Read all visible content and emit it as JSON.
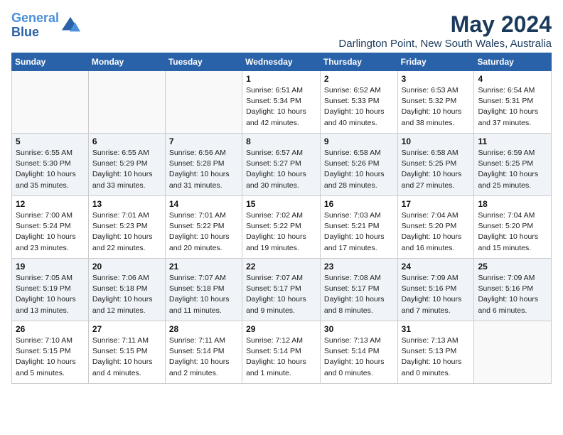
{
  "header": {
    "logo_line1": "General",
    "logo_line2": "Blue",
    "month": "May 2024",
    "location": "Darlington Point, New South Wales, Australia"
  },
  "days_of_week": [
    "Sunday",
    "Monday",
    "Tuesday",
    "Wednesday",
    "Thursday",
    "Friday",
    "Saturday"
  ],
  "weeks": [
    [
      {
        "day": "",
        "info": ""
      },
      {
        "day": "",
        "info": ""
      },
      {
        "day": "",
        "info": ""
      },
      {
        "day": "1",
        "info": "Sunrise: 6:51 AM\nSunset: 5:34 PM\nDaylight: 10 hours\nand 42 minutes."
      },
      {
        "day": "2",
        "info": "Sunrise: 6:52 AM\nSunset: 5:33 PM\nDaylight: 10 hours\nand 40 minutes."
      },
      {
        "day": "3",
        "info": "Sunrise: 6:53 AM\nSunset: 5:32 PM\nDaylight: 10 hours\nand 38 minutes."
      },
      {
        "day": "4",
        "info": "Sunrise: 6:54 AM\nSunset: 5:31 PM\nDaylight: 10 hours\nand 37 minutes."
      }
    ],
    [
      {
        "day": "5",
        "info": "Sunrise: 6:55 AM\nSunset: 5:30 PM\nDaylight: 10 hours\nand 35 minutes."
      },
      {
        "day": "6",
        "info": "Sunrise: 6:55 AM\nSunset: 5:29 PM\nDaylight: 10 hours\nand 33 minutes."
      },
      {
        "day": "7",
        "info": "Sunrise: 6:56 AM\nSunset: 5:28 PM\nDaylight: 10 hours\nand 31 minutes."
      },
      {
        "day": "8",
        "info": "Sunrise: 6:57 AM\nSunset: 5:27 PM\nDaylight: 10 hours\nand 30 minutes."
      },
      {
        "day": "9",
        "info": "Sunrise: 6:58 AM\nSunset: 5:26 PM\nDaylight: 10 hours\nand 28 minutes."
      },
      {
        "day": "10",
        "info": "Sunrise: 6:58 AM\nSunset: 5:25 PM\nDaylight: 10 hours\nand 27 minutes."
      },
      {
        "day": "11",
        "info": "Sunrise: 6:59 AM\nSunset: 5:25 PM\nDaylight: 10 hours\nand 25 minutes."
      }
    ],
    [
      {
        "day": "12",
        "info": "Sunrise: 7:00 AM\nSunset: 5:24 PM\nDaylight: 10 hours\nand 23 minutes."
      },
      {
        "day": "13",
        "info": "Sunrise: 7:01 AM\nSunset: 5:23 PM\nDaylight: 10 hours\nand 22 minutes."
      },
      {
        "day": "14",
        "info": "Sunrise: 7:01 AM\nSunset: 5:22 PM\nDaylight: 10 hours\nand 20 minutes."
      },
      {
        "day": "15",
        "info": "Sunrise: 7:02 AM\nSunset: 5:22 PM\nDaylight: 10 hours\nand 19 minutes."
      },
      {
        "day": "16",
        "info": "Sunrise: 7:03 AM\nSunset: 5:21 PM\nDaylight: 10 hours\nand 17 minutes."
      },
      {
        "day": "17",
        "info": "Sunrise: 7:04 AM\nSunset: 5:20 PM\nDaylight: 10 hours\nand 16 minutes."
      },
      {
        "day": "18",
        "info": "Sunrise: 7:04 AM\nSunset: 5:20 PM\nDaylight: 10 hours\nand 15 minutes."
      }
    ],
    [
      {
        "day": "19",
        "info": "Sunrise: 7:05 AM\nSunset: 5:19 PM\nDaylight: 10 hours\nand 13 minutes."
      },
      {
        "day": "20",
        "info": "Sunrise: 7:06 AM\nSunset: 5:18 PM\nDaylight: 10 hours\nand 12 minutes."
      },
      {
        "day": "21",
        "info": "Sunrise: 7:07 AM\nSunset: 5:18 PM\nDaylight: 10 hours\nand 11 minutes."
      },
      {
        "day": "22",
        "info": "Sunrise: 7:07 AM\nSunset: 5:17 PM\nDaylight: 10 hours\nand 9 minutes."
      },
      {
        "day": "23",
        "info": "Sunrise: 7:08 AM\nSunset: 5:17 PM\nDaylight: 10 hours\nand 8 minutes."
      },
      {
        "day": "24",
        "info": "Sunrise: 7:09 AM\nSunset: 5:16 PM\nDaylight: 10 hours\nand 7 minutes."
      },
      {
        "day": "25",
        "info": "Sunrise: 7:09 AM\nSunset: 5:16 PM\nDaylight: 10 hours\nand 6 minutes."
      }
    ],
    [
      {
        "day": "26",
        "info": "Sunrise: 7:10 AM\nSunset: 5:15 PM\nDaylight: 10 hours\nand 5 minutes."
      },
      {
        "day": "27",
        "info": "Sunrise: 7:11 AM\nSunset: 5:15 PM\nDaylight: 10 hours\nand 4 minutes."
      },
      {
        "day": "28",
        "info": "Sunrise: 7:11 AM\nSunset: 5:14 PM\nDaylight: 10 hours\nand 2 minutes."
      },
      {
        "day": "29",
        "info": "Sunrise: 7:12 AM\nSunset: 5:14 PM\nDaylight: 10 hours\nand 1 minute."
      },
      {
        "day": "30",
        "info": "Sunrise: 7:13 AM\nSunset: 5:14 PM\nDaylight: 10 hours\nand 0 minutes."
      },
      {
        "day": "31",
        "info": "Sunrise: 7:13 AM\nSunset: 5:13 PM\nDaylight: 10 hours\nand 0 minutes."
      },
      {
        "day": "",
        "info": ""
      }
    ]
  ]
}
